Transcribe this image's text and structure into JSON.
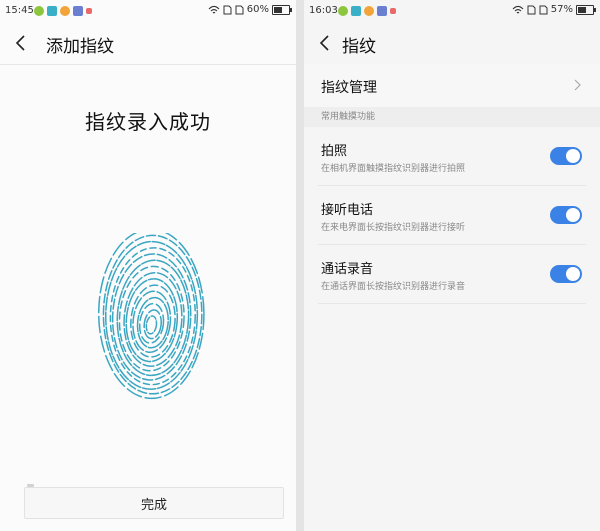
{
  "colors": {
    "accent": "#3b82e6",
    "fingerprint": "#3aa6c2"
  },
  "left": {
    "status": {
      "time": "15:45",
      "battery": "60%",
      "battery_level": 0.6
    },
    "title": "添加指纹",
    "success_text": "指纹录入成功",
    "done_label": "完成",
    "watermark": "bose",
    "icons": [
      "back-icon",
      "fingerprint-icon"
    ]
  },
  "right": {
    "status": {
      "time": "16:03",
      "battery": "57%",
      "battery_level": 0.57
    },
    "title": "指纹",
    "management": "指纹管理",
    "section": "常用触摸功能",
    "items": [
      {
        "title": "拍照",
        "subtitle": "在相机界面触摸指纹识别器进行拍照",
        "on": true
      },
      {
        "title": "接听电话",
        "subtitle": "在来电界面长按指纹识别器进行接听",
        "on": true
      },
      {
        "title": "通话录音",
        "subtitle": "在通话界面长按指纹识别器进行录音",
        "on": true
      }
    ]
  }
}
